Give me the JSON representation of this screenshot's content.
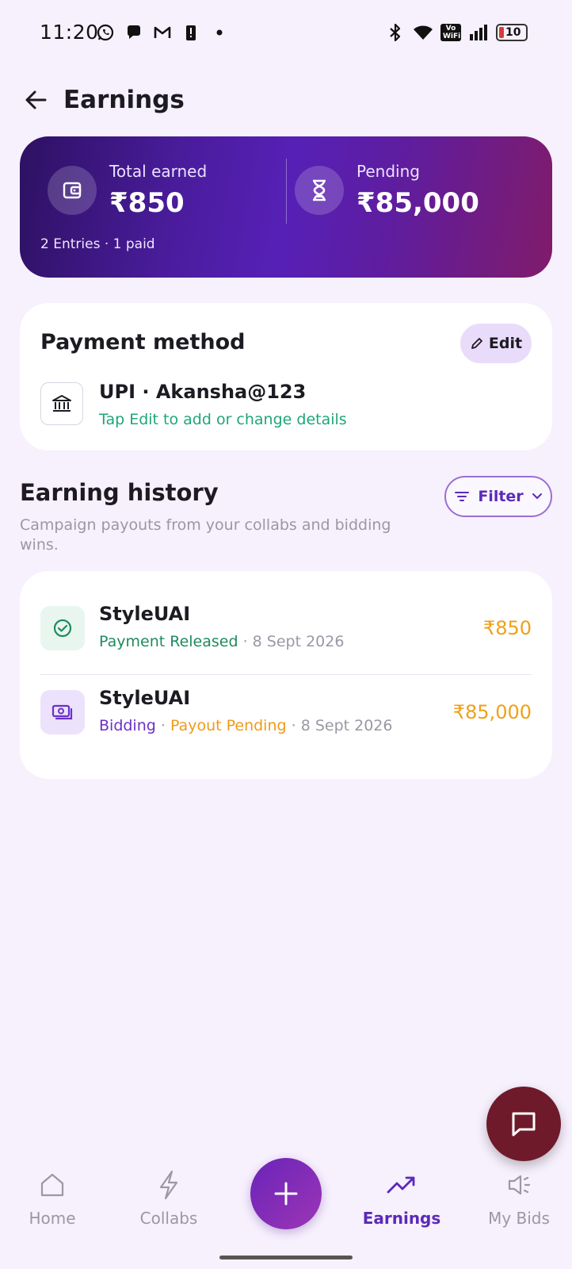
{
  "status_bar": {
    "time": "11:20",
    "vowifi": "Vo WiFi",
    "battery": "10",
    "left_icons": [
      "whatsapp-icon",
      "chat-bubble-icon",
      "gmail-icon",
      "alert-icon",
      "dot-icon"
    ],
    "right_icons": [
      "bluetooth-icon",
      "wifi-icon",
      "vowifi-icon",
      "signal-icon",
      "battery-icon"
    ]
  },
  "header": {
    "title": "Earnings"
  },
  "summary": {
    "total_label": "Total earned",
    "total_value": "₹850",
    "pending_label": "Pending",
    "pending_value": "₹85,000",
    "entries": "2 Entries · 1 paid"
  },
  "payment_method": {
    "title": "Payment method",
    "edit_label": "Edit",
    "upi": "UPI · Akansha@123",
    "hint": "Tap Edit to add or change details"
  },
  "history": {
    "title": "Earning history",
    "subtitle": "Campaign payouts from your collabs and bidding wins.",
    "filter_label": "Filter",
    "items": [
      {
        "name": "StyleUAI",
        "status": "Payment Released",
        "sep": " · ",
        "date": "8 Sept 2026",
        "amount": "₹850",
        "icon": "check-circle-icon"
      },
      {
        "name": "StyleUAI",
        "type": "Bidding",
        "status": "Payout Pending",
        "sep": " · ",
        "date": "8 Sept 2026",
        "amount": "₹85,000",
        "icon": "cash-icon"
      }
    ]
  },
  "bottom_nav": {
    "items": [
      {
        "label": "Home",
        "icon": "home-icon"
      },
      {
        "label": "Collabs",
        "icon": "bolt-icon"
      },
      {
        "label": "Earnings",
        "icon": "trending-up-icon",
        "active": true
      },
      {
        "label": "My Bids",
        "icon": "megaphone-icon"
      }
    ],
    "add_icon": "plus-icon"
  },
  "colors": {
    "accent": "#5b2ab8",
    "amount": "#f0a018",
    "released": "#1f8a5e",
    "hint": "#1fa67a",
    "chat_fab": "#6e1a2a"
  }
}
